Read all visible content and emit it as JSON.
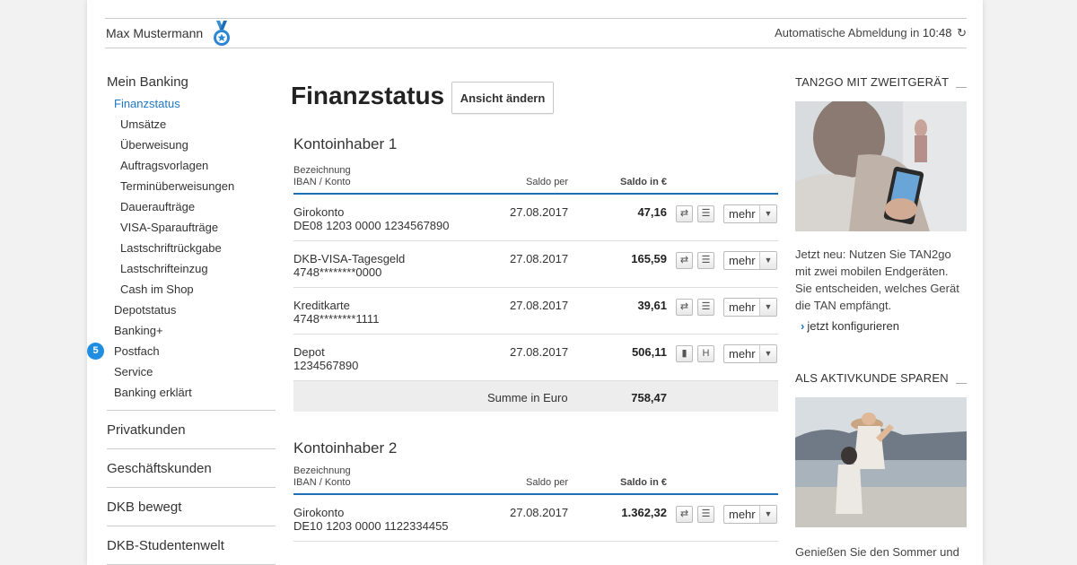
{
  "user": {
    "name": "Max Mustermann"
  },
  "logout": {
    "label": "Automatische Abmeldung in",
    "time": "10:48",
    "refresh_icon": "↻"
  },
  "sidebar": {
    "head": "Mein Banking",
    "items": [
      {
        "label": "Finanzstatus"
      },
      {
        "label": "Umsätze"
      },
      {
        "label": "Überweisung"
      },
      {
        "label": "Auftragsvorlagen"
      },
      {
        "label": "Terminüberweisungen"
      },
      {
        "label": "Daueraufträge"
      },
      {
        "label": "VISA-Sparaufträge"
      },
      {
        "label": "Lastschriftrückgabe"
      },
      {
        "label": "Lastschrifteinzug"
      },
      {
        "label": "Cash im Shop"
      },
      {
        "label": "Depotstatus"
      },
      {
        "label": "Banking+"
      },
      {
        "label": "Postfach",
        "badge": "5"
      },
      {
        "label": "Service"
      },
      {
        "label": "Banking erklärt"
      }
    ],
    "sections": [
      "Privatkunden",
      "Geschäftskunden",
      "DKB bewegt",
      "DKB-Studentenwelt"
    ]
  },
  "main": {
    "title": "Finanzstatus",
    "view_button": "Ansicht ändern",
    "table_headers": {
      "name": "Bezeichnung",
      "iban": "IBAN / Konto",
      "date": "Saldo per",
      "saldo": "Saldo in €"
    },
    "mehr_label": "mehr",
    "holders": [
      {
        "title": "Kontoinhaber 1",
        "rows": [
          {
            "name": "Girokonto",
            "iban": "DE08 1203 0000 1234567890",
            "date": "27.08.2017",
            "amount": "47,16"
          },
          {
            "name": "DKB-VISA-Tagesgeld",
            "iban": "4748********0000",
            "date": "27.08.2017",
            "amount": "165,59"
          },
          {
            "name": "Kreditkarte",
            "iban": "4748********1111",
            "date": "27.08.2017",
            "amount": "39,61"
          },
          {
            "name": "Depot",
            "iban": "1234567890",
            "date": "27.08.2017",
            "amount": "506,11"
          }
        ],
        "sum_label": "Summe in Euro",
        "sum_value": "758,47"
      },
      {
        "title": "Kontoinhaber 2",
        "rows": [
          {
            "name": "Girokonto",
            "iban": "DE10 1203 0000 1122334455",
            "date": "27.08.2017",
            "amount": "1.362,32"
          }
        ]
      }
    ]
  },
  "right": {
    "promo1": {
      "heading": "TAN2GO MIT ZWEITGERÄT",
      "text": "Jetzt neu: Nutzen Sie TAN2go mit zwei mobilen Endgeräten. Sie entscheiden, welches Gerät die TAN empfängt.",
      "link": "jetzt konfigurieren"
    },
    "promo2": {
      "heading": "ALS AKTIVKUNDE SPAREN",
      "text": "Genießen Sie den Sommer und"
    }
  },
  "colors": {
    "accent": "#1f77c4",
    "table_rule": "#1f6fb4",
    "badge": "#1f8ee0"
  }
}
